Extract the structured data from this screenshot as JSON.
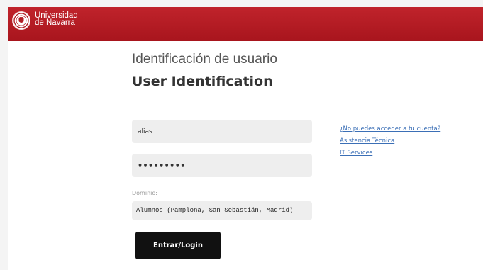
{
  "header": {
    "university_line1": "Universidad",
    "university_line2": "de Navarra",
    "accent_color": "#b01c24"
  },
  "title": {
    "spanish": "Identificación de usuario",
    "english": "User Identification"
  },
  "form": {
    "username_value": "alias",
    "password_value": "•••••••••",
    "domain_label": "Dominio:",
    "domain_value": "Alumnos (Pamplona, San Sebastián, Madrid)",
    "submit_label": "Entrar/Login"
  },
  "links": [
    {
      "label": "¿No puedes acceder a tu cuenta?"
    },
    {
      "label": "Asistencia Técnica"
    },
    {
      "label": "IT Services"
    }
  ],
  "icons": {
    "logo": "university-seal-icon"
  }
}
